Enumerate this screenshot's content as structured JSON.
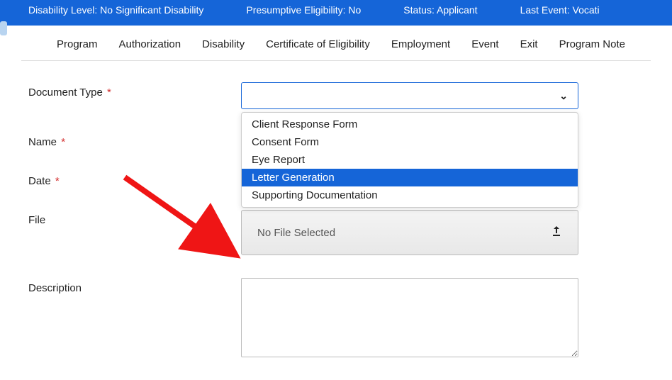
{
  "status_bar": {
    "disability": "Disability Level: No Significant Disability",
    "presumptive": "Presumptive Eligibility: No",
    "status": "Status: Applicant",
    "last_event": "Last Event: Vocati"
  },
  "tabs": {
    "program": "Program",
    "authorization": "Authorization",
    "disability": "Disability",
    "certificate": "Certificate of Eligibility",
    "employment": "Employment",
    "event": "Event",
    "exit": "Exit",
    "program_note": "Program Note"
  },
  "form": {
    "doc_type_label": "Document Type",
    "name_label": "Name",
    "date_label": "Date",
    "file_label": "File",
    "description_label": "Description",
    "no_file": "No File Selected"
  },
  "dropdown": {
    "opt0": "Client Response Form",
    "opt1": "Consent Form",
    "opt2": "Eye Report",
    "opt3": "Letter Generation",
    "opt4": "Supporting Documentation"
  }
}
